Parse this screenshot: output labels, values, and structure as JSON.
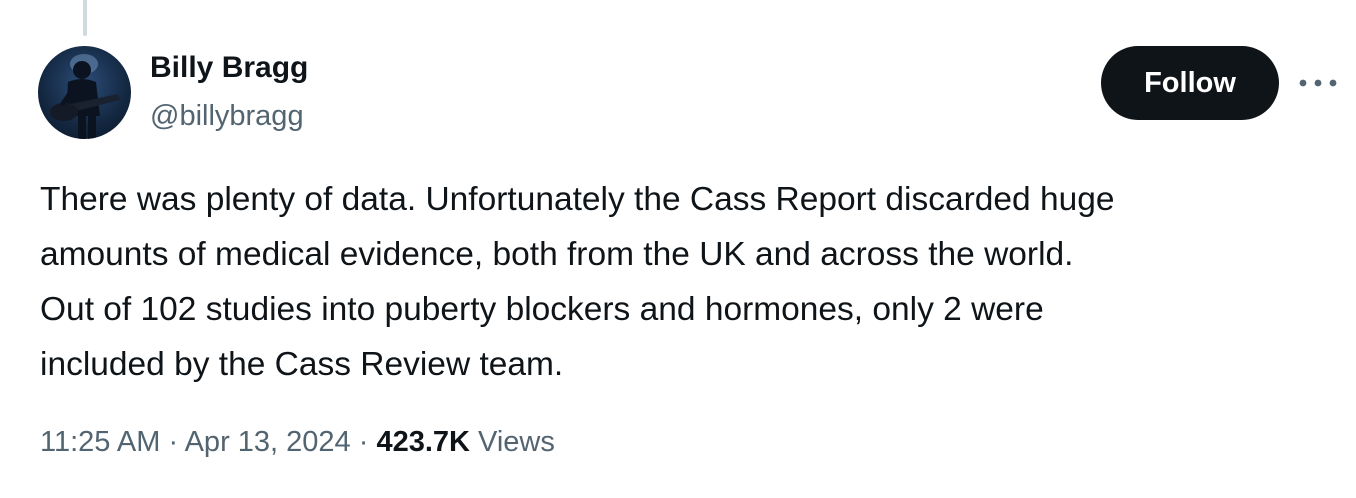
{
  "author": {
    "name": "Billy Bragg",
    "handle": "@billybragg"
  },
  "actions": {
    "follow_label": "Follow",
    "more_icon": "more-horizontal-icon"
  },
  "tweet": {
    "lines": [
      "There was plenty of data. Unfortunately the Cass Report discarded huge",
      "amounts of medical evidence, both from the UK and across the world.",
      "Out of 102 studies into puberty blockers and hormones, only 2 were",
      "included by the Cass Review team."
    ]
  },
  "meta": {
    "time": "11:25 AM",
    "separator": "·",
    "date": "Apr 13, 2024",
    "views_count": "423.7K",
    "views_label": "Views"
  },
  "colors": {
    "text_primary": "#0f1419",
    "text_secondary": "#536471",
    "follow_bg": "#0f1419",
    "thread_line": "#cfd9de"
  }
}
